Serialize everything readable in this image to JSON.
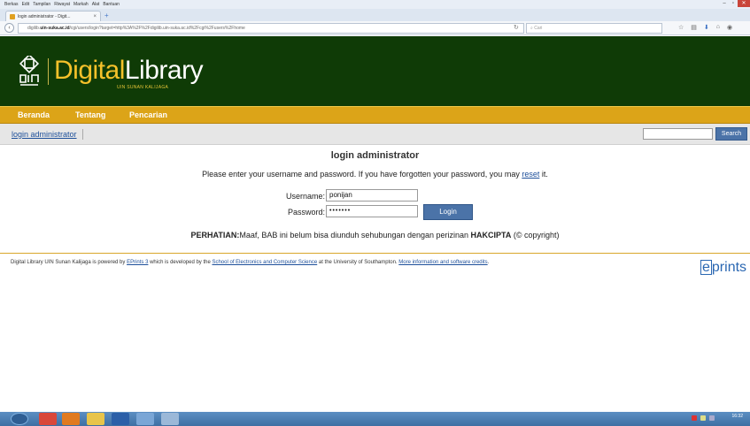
{
  "browser": {
    "menu": [
      "Berkas",
      "Edit",
      "Tampilan",
      "Riwayat",
      "Markah",
      "Alat",
      "Bantuan"
    ],
    "tab_title": "login administrator - Digit...",
    "url_prefix": "digilib.",
    "url_host": "uin-suka.ac.id",
    "url_rest": "/cgi/users/login?target=http%3A%2F%2Fdigilib.uin-suka.ac.id%2Fcgi%2Fusers%2Fhome",
    "search_placeholder": "Cari"
  },
  "site": {
    "logo_digital": "Digital",
    "logo_library": "Library",
    "logo_sub": "UIN SUNAN KALIJAGA",
    "nav": [
      "Beranda",
      "Tentang",
      "Pencarian"
    ],
    "login_link": "login administrator",
    "search_button": "Search",
    "colors": {
      "header": "#0f3b06",
      "nav": "#dca418",
      "accent": "#f5c12a",
      "button": "#4b73a8"
    }
  },
  "login": {
    "title": "login administrator",
    "intro_before": "Please enter your username and password. If you have forgotten your password, you may ",
    "intro_link": "reset",
    "intro_after": " it.",
    "username_label": "Username:",
    "username_value": "ponijan",
    "password_label": "Password:",
    "password_value": "•••••••",
    "button": "Login",
    "notice_bold1": "PERHATIAN:",
    "notice_text": "Maaf, BAB ini belum bisa diunduh sehubungan dengan perizinan ",
    "notice_bold2": "HAKCIPTA",
    "notice_tail": " (© copyright)"
  },
  "footer": {
    "part1": "Digital Library UIN Sunan Kalijaga is powered by ",
    "link1": "EPrints 3",
    "part2": " which is developed by the ",
    "link2": "School of Electronics and Computer Science",
    "part3": " at the University of Southampton. ",
    "link3": "More information and software credits",
    "part4": ".",
    "eprints_e": "e",
    "eprints_rest": "prints"
  },
  "taskbar": {
    "clock": "16:32"
  }
}
